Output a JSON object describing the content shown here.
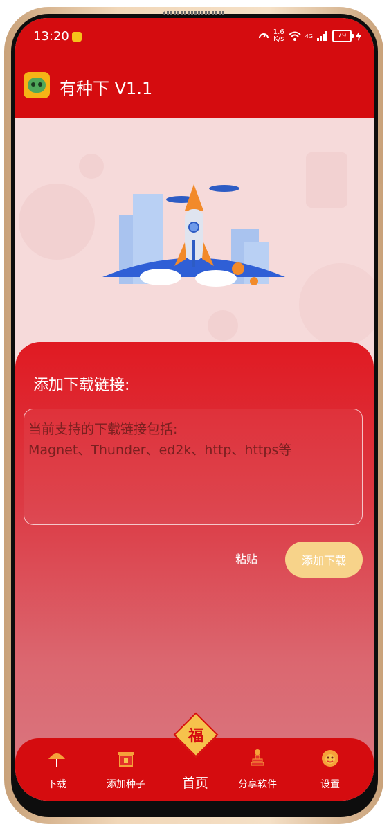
{
  "status_bar": {
    "time": "13:20",
    "speed_value": "1.6",
    "speed_unit": "K/s",
    "network": "4G",
    "battery": "79"
  },
  "app_bar": {
    "title": "有种下 V1.1"
  },
  "main": {
    "section_title": "添加下载链接:",
    "input_placeholder": "当前支持的下载链接包括:\nMagnet、Thunder、ed2k、http、https等",
    "paste_label": "粘贴",
    "add_download_label": "添加下载"
  },
  "bottom_nav": {
    "items": [
      {
        "label": "下载",
        "icon": "fan-icon"
      },
      {
        "label": "添加种子",
        "icon": "gate-icon"
      },
      {
        "label": "首页",
        "icon": "fu-badge-icon"
      },
      {
        "label": "分享软件",
        "icon": "firecracker-icon"
      },
      {
        "label": "设置",
        "icon": "lion-head-icon"
      }
    ],
    "center_badge": "福"
  },
  "colors": {
    "primary_red": "#d50c0f",
    "accent_gold": "#f7d38a"
  }
}
